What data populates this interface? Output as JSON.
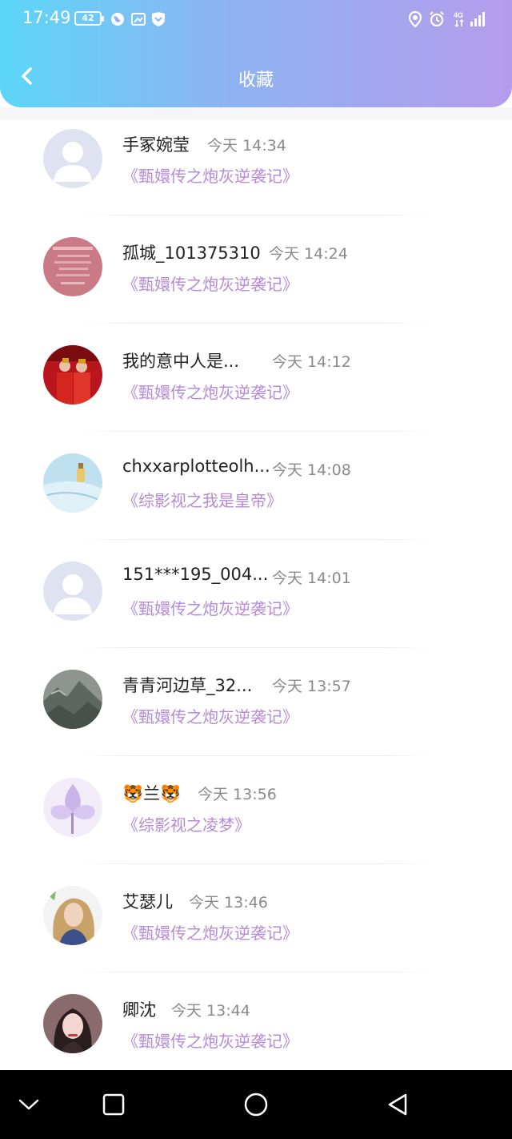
{
  "status": {
    "time": "17:49",
    "battery": "42",
    "network": "4G"
  },
  "header": {
    "title": "收藏",
    "colors": {
      "from": "#5cd6f6",
      "to": "#b59cec"
    }
  },
  "accent": "#b58ad8",
  "items": [
    {
      "name": "手冢婉莹",
      "time": "今天 14:34",
      "book": "《甄嬛传之炮灰逆袭记》",
      "avatar": "default-avatar"
    },
    {
      "name": "孤城_101375310",
      "time": "今天 14:24",
      "book": "《甄嬛传之炮灰逆袭记》",
      "avatar": "pink-photo-avatar"
    },
    {
      "name": "我的意中人是...",
      "time": "今天 14:12",
      "book": "《甄嬛传之炮灰逆袭记》",
      "avatar": "red-wedding-avatar"
    },
    {
      "name": "chxxarplotteolh...",
      "time": "今天 14:08",
      "book": "《综影视之我是皇帝》",
      "avatar": "blue-bottle-avatar"
    },
    {
      "name": "151***195_004...",
      "time": "今天 14:01",
      "book": "《甄嬛传之炮灰逆袭记》",
      "avatar": "default-avatar"
    },
    {
      "name": "青青河边草_32...",
      "time": "今天 13:57",
      "book": "《甄嬛传之炮灰逆袭记》",
      "avatar": "mountain-avatar"
    },
    {
      "name": "🐯兰🐯",
      "time": "今天 13:56",
      "book": "《综影视之凌梦》",
      "avatar": "purple-flower-avatar"
    },
    {
      "name": "艾瑟儿",
      "time": "今天 13:46",
      "book": "《甄嬛传之炮灰逆袭记》",
      "avatar": "blonde-girl-avatar"
    },
    {
      "name": "卿沈",
      "time": "今天 13:44",
      "book": "《甄嬛传之炮灰逆袭记》",
      "avatar": "girl-portrait-avatar"
    }
  ]
}
